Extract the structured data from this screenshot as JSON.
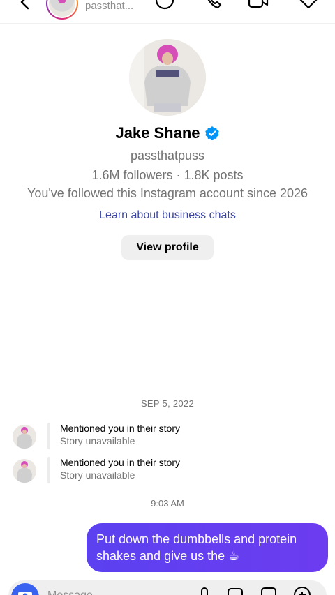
{
  "header": {
    "username": "passthat...",
    "icons": [
      "back-arrow-icon",
      "sticker-icon",
      "phone-icon",
      "video-icon",
      "heart-icon"
    ]
  },
  "profile": {
    "name": "Jake Shane",
    "handle": "passthatpuss",
    "stats": "1.6M followers · 1.8K posts",
    "since": "You've followed this Instagram account since 2026",
    "learn_link": "Learn about business chats",
    "view_profile_label": "View profile"
  },
  "messages": {
    "date": "SEP 5, 2022",
    "mentions": [
      {
        "title": "Mentioned you in their story",
        "subtitle": "Story unavailable"
      },
      {
        "title": "Mentioned you in their story",
        "subtitle": "Story unavailable"
      }
    ],
    "time": "9:03 AM",
    "sent_text": "Put down the dumbbells and protein shakes and give us the ☕"
  },
  "composer": {
    "placeholder": "Message..."
  },
  "colors": {
    "accent": "#5b41f0",
    "verified": "#0095f6",
    "link": "#3a45a8",
    "camera": "#3a62f0"
  }
}
